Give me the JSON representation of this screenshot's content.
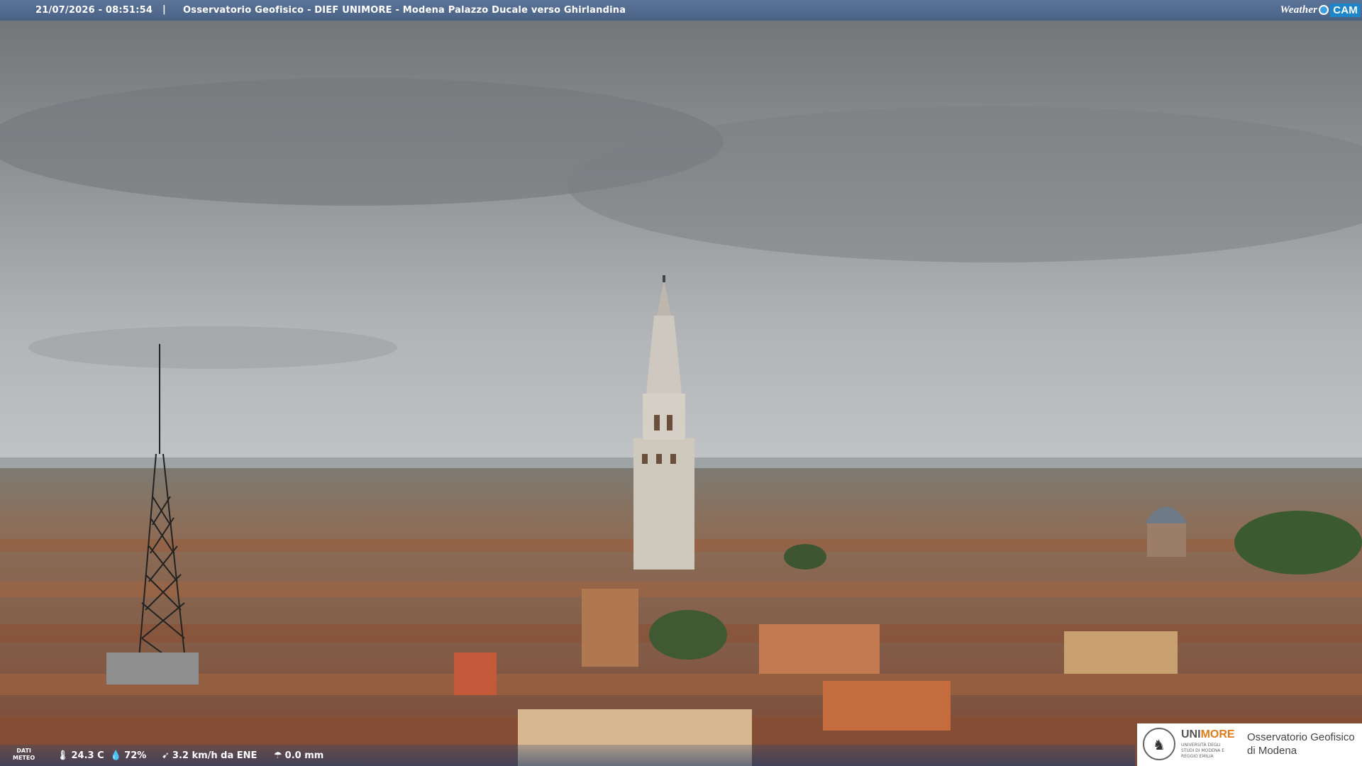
{
  "header": {
    "datetime": "21/07/2026 - 08:51:54",
    "separator": "|",
    "title": "Osservatorio Geofisico - DIEF UNIMORE - Modena Palazzo Ducale verso Ghirlandina"
  },
  "brand": {
    "weather": "Weather",
    "cam": "CAM"
  },
  "footer": {
    "label_line1": "DATI",
    "label_line2": "METEO",
    "temperature": "24.3 C",
    "humidity": "72%",
    "wind": "3.2 km/h da ENE",
    "rain": "0.0 mm"
  },
  "logo": {
    "uni_main": "UNI",
    "uni_accent": "MORE",
    "uni_subtitle": "UNIVERSITÀ DEGLI STUDI DI MODENA E REGGIO EMILIA",
    "observatory_line1": "Osservatorio Geofisico",
    "observatory_line2": "di Modena"
  },
  "colors": {
    "top_bar": "#5b7396",
    "brand_cam": "#1d86c9",
    "unimore_accent": "#e07b1a"
  }
}
